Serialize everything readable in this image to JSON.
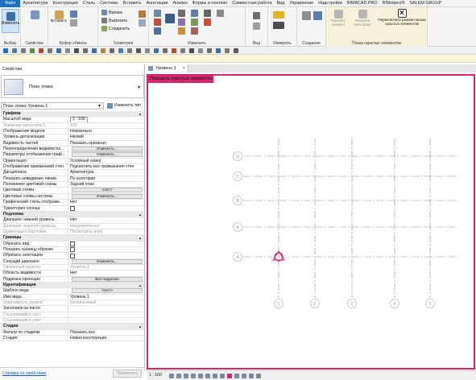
{
  "menu": [
    "Файл",
    "Архитектура",
    "Конструкция",
    "Сталь",
    "Системы",
    "Вставить",
    "Аннотации",
    "Анализ",
    "Формы и генплан",
    "Совместная работа",
    "Вид",
    "Управление",
    "Надстройки",
    "BIMACAD.PRO",
    "BIMobject®",
    "SALEM GROUP"
  ],
  "ribbon": {
    "modify_label": "Изменить",
    "select_label": "Выбор",
    "properties_label": "Свойства",
    "clipboard_label": "Буфер обмена",
    "paste_label": "Вставить",
    "cut_label": "Вырезать",
    "join_label": "Соединить",
    "notch_label": "Врезка",
    "geometry_label": "Геометрия",
    "modify_group_label": "Изменить",
    "view_label": "Вид",
    "measure_label": "Измерить",
    "create_label": "Создание",
    "reveal_element_label": "Показать элемент",
    "reveal_category_label": "Показать категорию",
    "toggle_reveal_label": "Переключить режим показа скрытых элементов",
    "reveal_group_label": "Показ скрытых элементов"
  },
  "properties": {
    "title": "Свойства",
    "type_name": "План этажа",
    "instance_selector": "План этажа: Уровень 1",
    "edit_type": "Изменить тип",
    "rows": [
      {
        "kind": "section",
        "k": "Графика"
      },
      {
        "k": "Масштаб вида",
        "v": "1 : 100",
        "style": "boxed"
      },
      {
        "k": "Значение масштаба    1:",
        "v": "100",
        "dim": true
      },
      {
        "k": "Отображение модели",
        "v": "Нормально"
      },
      {
        "k": "Уровень детализации",
        "v": "Низкий"
      },
      {
        "k": "Видимость частей",
        "v": "Показать оригинал"
      },
      {
        "k": "Переопределения видимости/...",
        "v": "Изменить...",
        "style": "btn"
      },
      {
        "k": "Параметры отображения граф...",
        "v": "Изменить...",
        "style": "btn"
      },
      {
        "k": "Ориентация",
        "v": "Условный север"
      },
      {
        "k": "Отображение примыканий стен",
        "v": "Подчистить все примыкания стен"
      },
      {
        "k": "Дисциплина",
        "v": "Архитектура"
      },
      {
        "k": "Показать невидимые линии",
        "v": "По категории"
      },
      {
        "k": "Положение цветовой схемы",
        "v": "Задний план"
      },
      {
        "k": "Цветовая схема",
        "v": "<нет>",
        "style": "btn"
      },
      {
        "k": "Цветовые схемы системы",
        "v": "Изменить...",
        "style": "btn"
      },
      {
        "k": "Графический стиль отображе...",
        "v": "Нет"
      },
      {
        "k": "Траектория солнца",
        "v": "",
        "style": "cb"
      },
      {
        "kind": "section",
        "k": "Подложка"
      },
      {
        "k": "Диапазон: нижний уровень",
        "v": "Нет"
      },
      {
        "k": "Диапазон: верхний уровень",
        "v": "Неограниченно",
        "dim": true
      },
      {
        "k": "Ориентация подложки",
        "v": "Посмотреть вниз",
        "dim": true
      },
      {
        "kind": "section",
        "k": "Границы"
      },
      {
        "k": "Обрезать вид",
        "v": "",
        "style": "cb"
      },
      {
        "k": "Показать границу обрезки",
        "v": "",
        "style": "cb"
      },
      {
        "k": "Обрезать аннотации",
        "v": "",
        "style": "cb"
      },
      {
        "k": "Секущий диапазон",
        "v": "Изменить...",
        "style": "btn"
      },
      {
        "k": "Связанный уровень",
        "v": "Уровень 1",
        "dim": true
      },
      {
        "k": "Область видимости",
        "v": "Нет"
      },
      {
        "k": "Подрезка проекции",
        "v": "Без подрезки",
        "style": "btn"
      },
      {
        "kind": "section",
        "k": "Идентификация"
      },
      {
        "k": "Шаблон вида",
        "v": "<Нет>",
        "style": "btn"
      },
      {
        "k": "Имя вида",
        "v": "Уровень 1"
      },
      {
        "k": "Зависимость уровня",
        "v": "Независимый",
        "dim": true
      },
      {
        "k": "Заголовок на листе",
        "v": ""
      },
      {
        "k": "Ссылающийся лист",
        "v": "",
        "dim": true
      },
      {
        "k": "Ссылающийся узел",
        "v": "",
        "dim": true
      },
      {
        "kind": "section",
        "k": "Стадии"
      },
      {
        "k": "Фильтр по стадиям",
        "v": "Показать все"
      },
      {
        "k": "Стадия",
        "v": "Новая конструкция"
      }
    ],
    "help_link": "Справка по свойствам",
    "apply": "Применить"
  },
  "view": {
    "tab": "Уровень 1",
    "close_glyph": "×",
    "banner": "Показать скрытые элементы",
    "scale": "1 : 100",
    "row_bubbles": [
      "D",
      "C",
      "B",
      "A",
      "A"
    ],
    "col_bubbles": [
      "1",
      "2",
      "3",
      "4",
      "5"
    ]
  },
  "colors": {
    "accent": "#d6246e",
    "file_tab": "#1c6fc4"
  }
}
